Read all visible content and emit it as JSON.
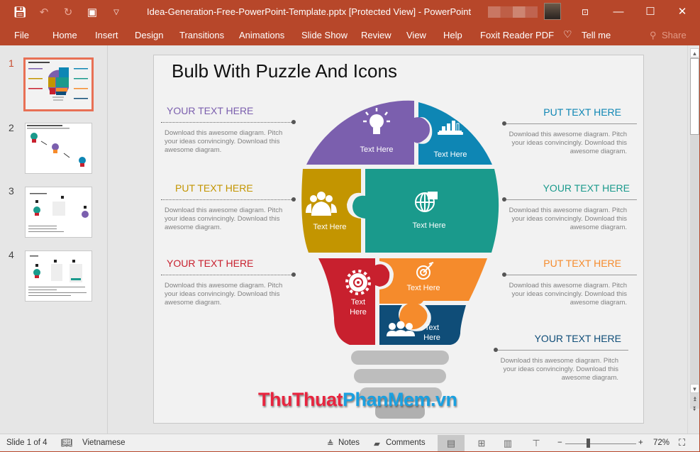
{
  "app": {
    "window_title": "Idea-Generation-Free-PowerPoint-Template.pptx [Protected View]  -  PowerPoint",
    "accent_color": "#b7472a"
  },
  "quick_access": {
    "icons": [
      "save-icon",
      "undo-icon",
      "redo-icon",
      "start-from-beginning-icon",
      "customize-qat-icon"
    ]
  },
  "window_controls": {
    "ribbon_display": "ribbon-display-options-icon",
    "minimize": "—",
    "maximize": "☐",
    "close": "✕"
  },
  "ribbon": {
    "tabs": [
      "File",
      "Home",
      "Insert",
      "Design",
      "Transitions",
      "Animations",
      "Slide Show",
      "Review",
      "View",
      "Help",
      "Foxit Reader PDF"
    ],
    "tell_me": "Tell me",
    "share": "Share"
  },
  "thumbnails": [
    {
      "number": "1",
      "active": true
    },
    {
      "number": "2",
      "active": false
    },
    {
      "number": "3",
      "active": false
    },
    {
      "number": "4",
      "active": false
    }
  ],
  "slide": {
    "title": "Bulb With Puzzle And Icons",
    "left_blocks": [
      {
        "heading": "YOUR TEXT HERE",
        "color": "#7b5fae",
        "body": "Download this awesome diagram. Pitch your ideas convincingly. Download this awesome diagram."
      },
      {
        "heading": "PUT TEXT HERE",
        "color": "#c39500",
        "body": "Download this awesome diagram. Pitch your ideas convincingly. Download this awesome diagram."
      },
      {
        "heading": "YOUR TEXT HERE",
        "color": "#c8202e",
        "body": "Download this awesome diagram. Pitch your ideas convincingly. Download this awesome diagram."
      }
    ],
    "right_blocks": [
      {
        "heading": "PUT TEXT HERE",
        "color": "#0e86b4",
        "body": "Download this awesome diagram. Pitch your ideas convincingly. Download this awesome diagram."
      },
      {
        "heading": "YOUR TEXT HERE",
        "color": "#1a9a8c",
        "body": "Download this awesome diagram. Pitch your ideas convincingly. Download this awesome diagram."
      },
      {
        "heading": "PUT TEXT HERE",
        "color": "#f58b2c",
        "body": "Download this awesome diagram. Pitch your ideas convincingly. Download this awesome diagram."
      },
      {
        "heading": "YOUR TEXT HERE",
        "color": "#0f4d78",
        "body": "Download this awesome diagram. Pitch your ideas convincingly. Download this awesome diagram."
      }
    ],
    "puzzle_pieces": [
      {
        "label": "Text Here",
        "icon": "lightbulb-icon",
        "color": "#7b5fae"
      },
      {
        "label": "Text Here",
        "icon": "bar-chart-laptop-icon",
        "color": "#0e86b4"
      },
      {
        "label": "Text Here",
        "icon": "team-icon",
        "color": "#c39500"
      },
      {
        "label": "Text Here",
        "icon": "globe-chat-icon",
        "color": "#1a9a8c"
      },
      {
        "label_line1": "Text",
        "label_line2": "Here",
        "icon": "gear-icon",
        "color": "#c8202e"
      },
      {
        "label": "Text Here",
        "icon": "target-icon",
        "color": "#f58b2c"
      },
      {
        "label_line1": "Text",
        "label_line2": "Here",
        "icon": "people-group-icon",
        "color": "#0f4d78"
      }
    ],
    "base_color": "#bdbdbd"
  },
  "watermark": {
    "part1": "ThuThuat",
    "part2": "PhanMem.vn",
    "color1": "#e8243e",
    "color2": "#1aa0e0"
  },
  "status_bar": {
    "slide_counter": "Slide 1 of 4",
    "language": "Vietnamese",
    "notes": "Notes",
    "comments": "Comments",
    "zoom_minus": "−",
    "zoom_plus": "+",
    "zoom_level": "72%",
    "zoom_percent": 72
  }
}
